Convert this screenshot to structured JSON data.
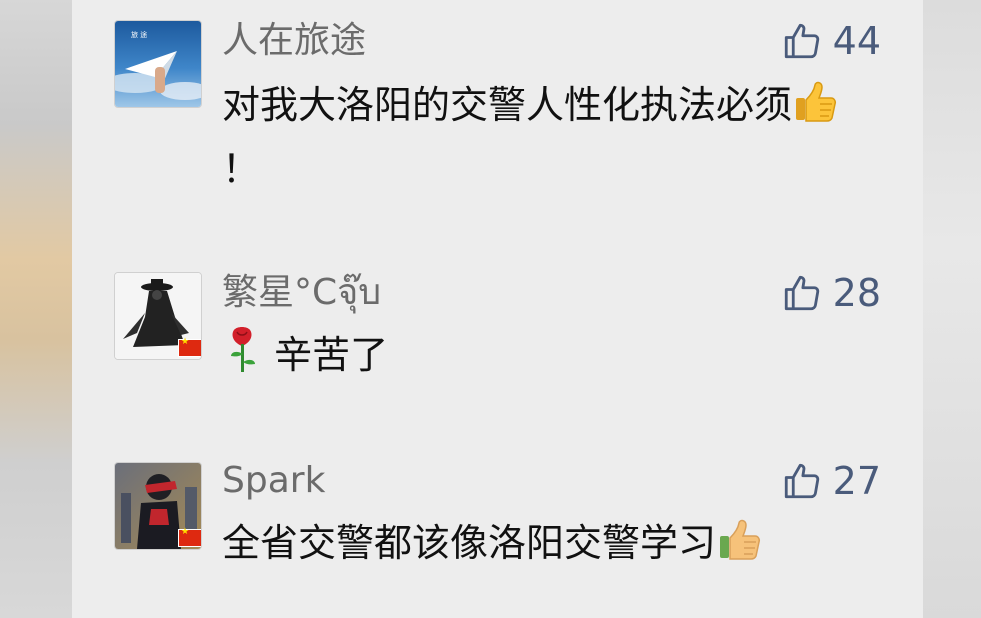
{
  "comments": [
    {
      "name": "人在旅途",
      "likes": "44",
      "text": "对我大洛阳的交警人性化执法必须",
      "text_suffix": "！",
      "emoji": "thumbs-up"
    },
    {
      "name": "繁星°Cจุ๊บ",
      "likes": "28",
      "text": "辛苦了",
      "emoji": "rose"
    },
    {
      "name": "Spark",
      "likes": "27",
      "text": "全省交警都该像洛阳交警学习",
      "emoji": "thumbs-up"
    }
  ],
  "icons": {
    "like_icon": "thumbs-up-outline-icon",
    "thumb_emoji": "thumbs-up-emoji-icon",
    "rose_emoji": "rose-emoji-icon",
    "flag": "china-flag-icon"
  },
  "colors": {
    "background": "#ededed",
    "name": "#6b6b6b",
    "likes": "#4a5b7b",
    "text": "#111111"
  }
}
